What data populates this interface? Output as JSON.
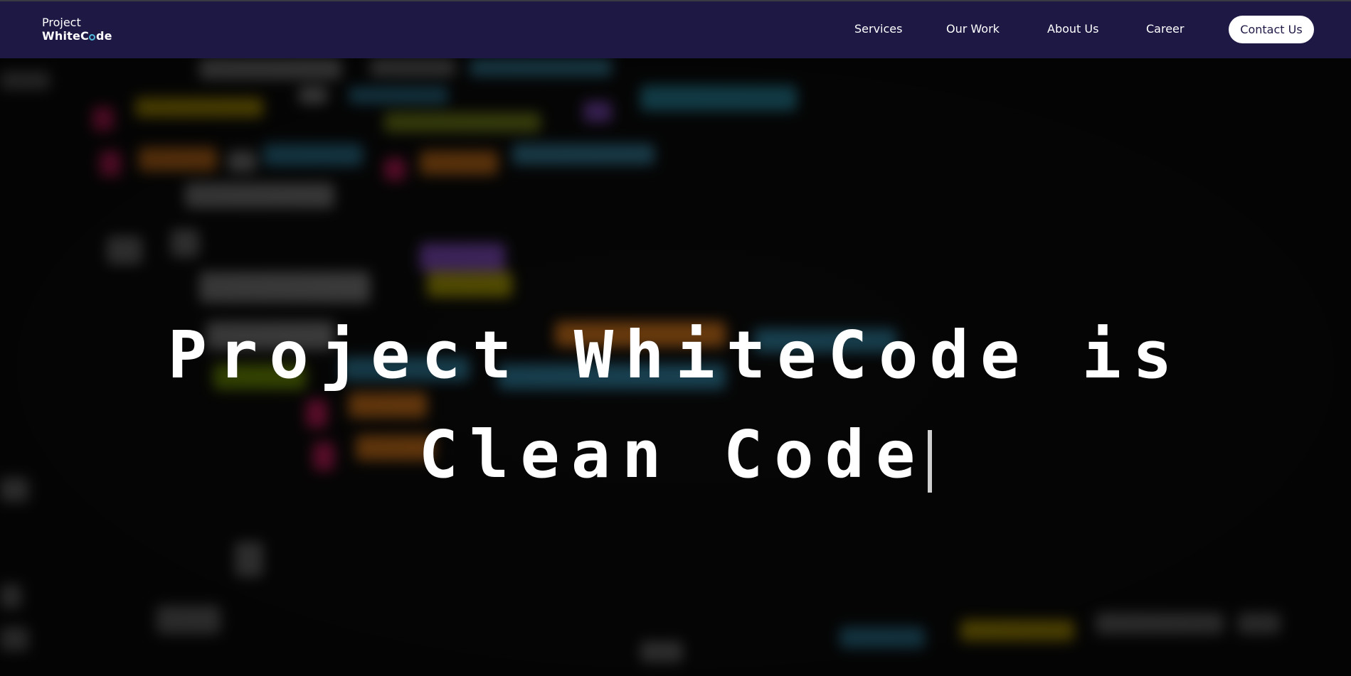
{
  "logo": {
    "line1": "Project",
    "line2_prefix": "WhiteC",
    "line2_suffix": "de"
  },
  "nav": {
    "items": [
      {
        "label": "Services"
      },
      {
        "label": "Our Work"
      },
      {
        "label": "About Us"
      },
      {
        "label": "Career"
      }
    ],
    "contact_label": "Contact Us"
  },
  "hero": {
    "headline_line1": "Project WhiteCode is",
    "headline_line2": "Clean Code"
  },
  "colors": {
    "navbar_bg": "#1e1845",
    "accent": "#4fb8d8",
    "contact_button_bg": "#ffffff",
    "hero_text": "#ffffff"
  }
}
